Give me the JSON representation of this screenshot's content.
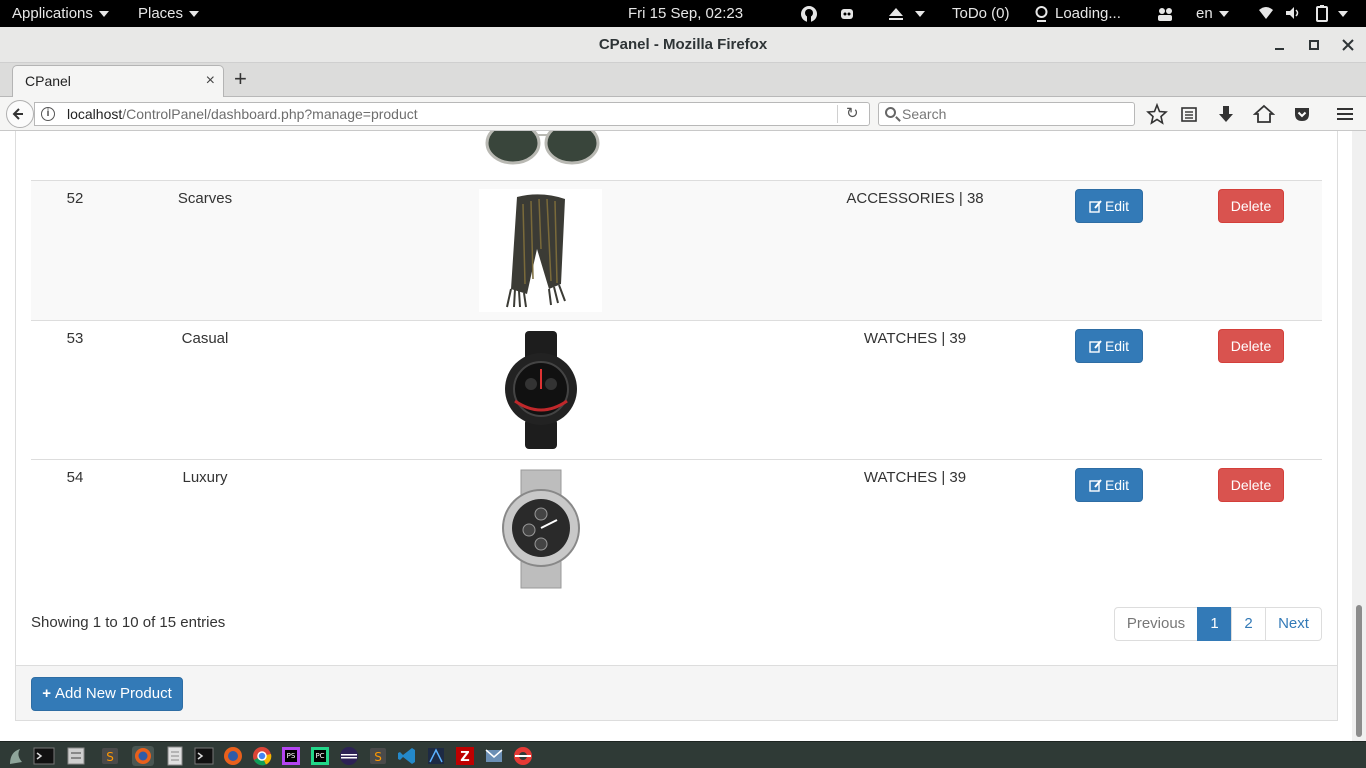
{
  "topbar": {
    "applications": "Applications",
    "places": "Places",
    "clock": "Fri 15 Sep, 02:23",
    "todo": "ToDo (0)",
    "loading": "Loading...",
    "language": "en"
  },
  "window": {
    "title": "CPanel - Mozilla Firefox"
  },
  "tabs": [
    {
      "label": "CPanel"
    }
  ],
  "navbar": {
    "url_host": "localhost",
    "url_path": "/ControlPanel/dashboard.php?manage=product",
    "search_placeholder": "Search"
  },
  "table": {
    "rows": [
      {
        "id": "52",
        "name": "Scarves",
        "category": "ACCESSORIES | 38",
        "image_icon": "scarf-image"
      },
      {
        "id": "53",
        "name": "Casual",
        "category": "WATCHES | 39",
        "image_icon": "watch-image"
      },
      {
        "id": "54",
        "name": "Luxury",
        "category": "WATCHES | 39",
        "image_icon": "watch-image"
      }
    ],
    "edit_label": "Edit",
    "delete_label": "Delete"
  },
  "pagination": {
    "info": "Showing 1 to 10 of 15 entries",
    "previous": "Previous",
    "pages": [
      "1",
      "2"
    ],
    "current": "1",
    "next": "Next"
  },
  "footer": {
    "add_button": "Add New Product"
  },
  "colors": {
    "primary": "#337ab7",
    "danger": "#d9534f",
    "topbar": "#000000",
    "taskbar": "#2f3a36"
  }
}
